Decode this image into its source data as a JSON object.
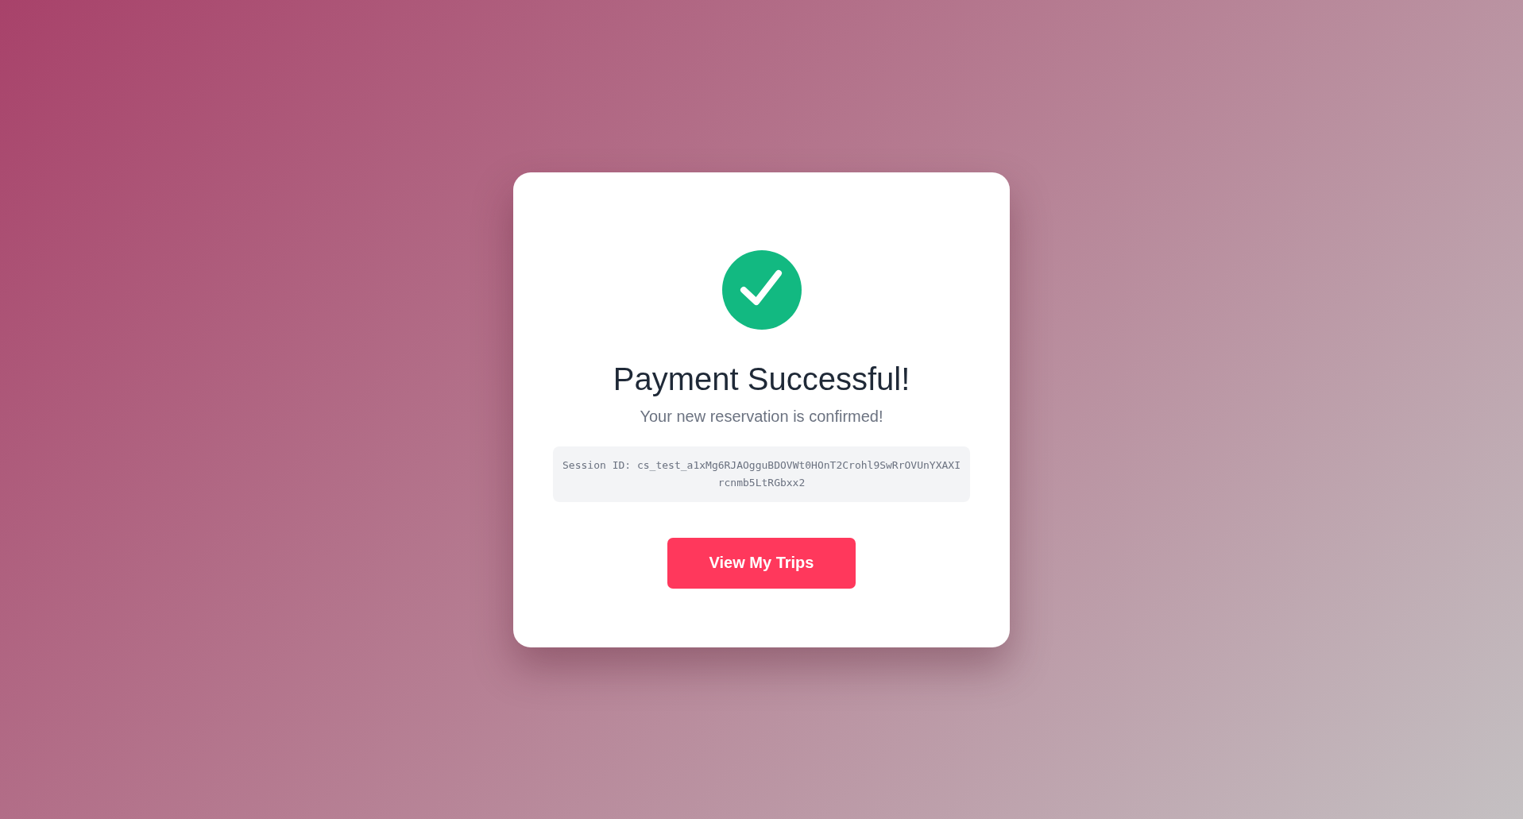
{
  "status": {
    "kind": "success"
  },
  "title": "Payment Successful!",
  "subtitle": "Your new reservation is confirmed!",
  "session": "Session ID: cs_test_a1xMg6RJAOgguBDOVWt0HOnT2Crohl9SwRrOVUnYXAXIrcnmb5LtRGbxx2",
  "button": "View My Trips"
}
